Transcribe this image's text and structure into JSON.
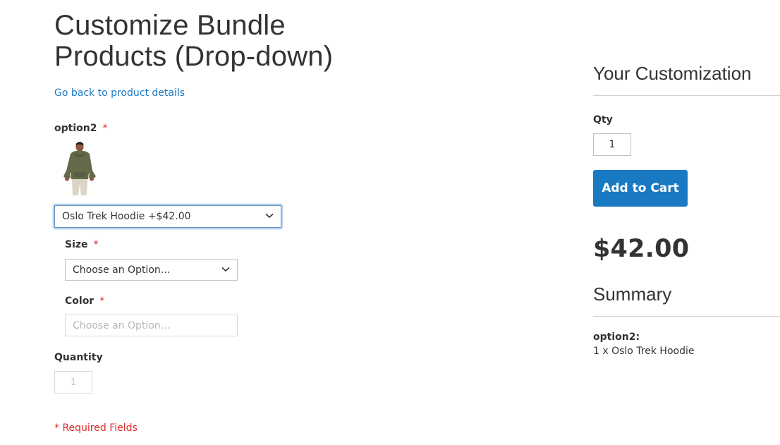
{
  "title": "Customize Bundle Products (Drop-down)",
  "back_link": "Go back to product details",
  "required_mark": "*",
  "option2": {
    "label": "option2",
    "image_alt": "Oslo Trek Hoodie",
    "selected": "Oslo Trek Hoodie +$42.00"
  },
  "size": {
    "label": "Size",
    "selected": "Choose an Option..."
  },
  "color": {
    "label": "Color",
    "placeholder": "Choose an Option..."
  },
  "quantity": {
    "label": "Quantity",
    "value": "1"
  },
  "required_fields": "* Required Fields",
  "customization": {
    "heading": "Your Customization",
    "qty_label": "Qty",
    "qty_value": "1",
    "add_to_cart": "Add to Cart",
    "price": "$42.00"
  },
  "summary": {
    "heading": "Summary",
    "option_title": "option2:",
    "option_item": "1 x Oslo Trek Hoodie"
  },
  "colors": {
    "accent": "#1979c3",
    "required": "#e02b27",
    "text": "#333333",
    "focus_glow": "#68a8e0"
  }
}
